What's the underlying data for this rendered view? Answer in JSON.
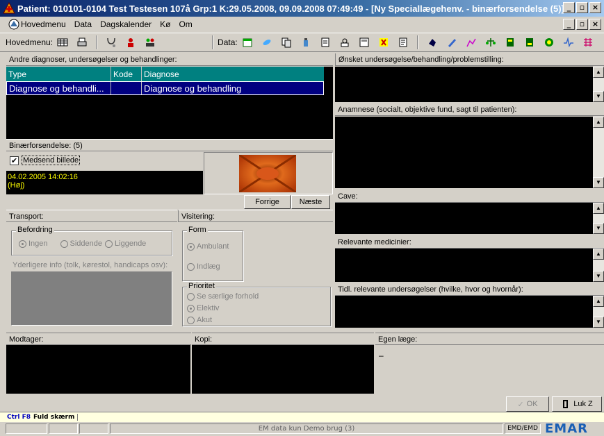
{
  "window": {
    "title": "Patient: 010101-0104 Test  Testesen 107å Grp:1 K:29.05.2008, 09.09.2008 07:49:49 - [Ny Speciallægehenv. - binærforsendelse (5)]",
    "minimize": "_",
    "maximize": "▫",
    "close": "×"
  },
  "menu": {
    "items": [
      "Hovedmenu",
      "Data",
      "Dagskalender",
      "Kø",
      "Om"
    ]
  },
  "toolbar": {
    "hovedmenu_label": "Hovedmenu:",
    "data_label": "Data:"
  },
  "diagnoses": {
    "header": "Andre diagnoser, undersøgelser og behandlinger:",
    "columns": [
      "Type",
      "Kode",
      "Diagnose"
    ],
    "rows": [
      {
        "type": "Diagnose og behandli...",
        "kode": "",
        "diagnose": "Diagnose og behandling"
      }
    ]
  },
  "binary": {
    "header": "Binærforsendelse: (5)",
    "checkbox_label": "Medsend billede",
    "checked": true,
    "timestamp": "04.02.2005 14:02:16",
    "caption": "(Høj)",
    "prev_button": "Forrige",
    "next_button": "Næste"
  },
  "transport": {
    "header": "Transport:",
    "befordring_label": "Befordring",
    "options": [
      "Ingen",
      "Siddende",
      "Liggende"
    ],
    "selected": "Ingen",
    "extra_label": "Yderligere info (tolk, kørestol, handicaps osv):"
  },
  "visitering": {
    "header": "Visitering:",
    "form_label": "Form",
    "form_options": [
      "Ambulant",
      "Indlæg"
    ],
    "form_selected": "Ambulant",
    "prioritet_label": "Prioritet",
    "prioritet_options": [
      "Se særlige forhold",
      "Elektiv",
      "Akut"
    ],
    "prioritet_selected": "Elektiv"
  },
  "right": {
    "onsket": "Ønsket undersøgelse/behandling/problemstilling:",
    "anamnese": "Anamnese (socialt, objektive fund, sagt til patienten):",
    "cave": "Cave:",
    "medicin": "Relevante medicinier:",
    "tidl": "Tidl. relevante undersøgelser (hvilke, hvor og hvornår):"
  },
  "bottom": {
    "modtager": "Modtager:",
    "kopi": "Kopi:",
    "egen_laege": "Egen læge:",
    "egen_laege_value": "–",
    "ok_button": "OK",
    "close_button": "Luk Z"
  },
  "shortcut": {
    "key": "Ctrl F8",
    "label": "Fuld skærm"
  },
  "status": {
    "center": "EM data kun Demo brug (3)",
    "user": "EMD/EMD",
    "logo": "EMAR"
  },
  "colors": {
    "titlebar": "#0a246a",
    "table_header": "#008080",
    "table_selection": "#000080",
    "logo": "#1a5fb4",
    "timestamp": "#ffff00"
  }
}
